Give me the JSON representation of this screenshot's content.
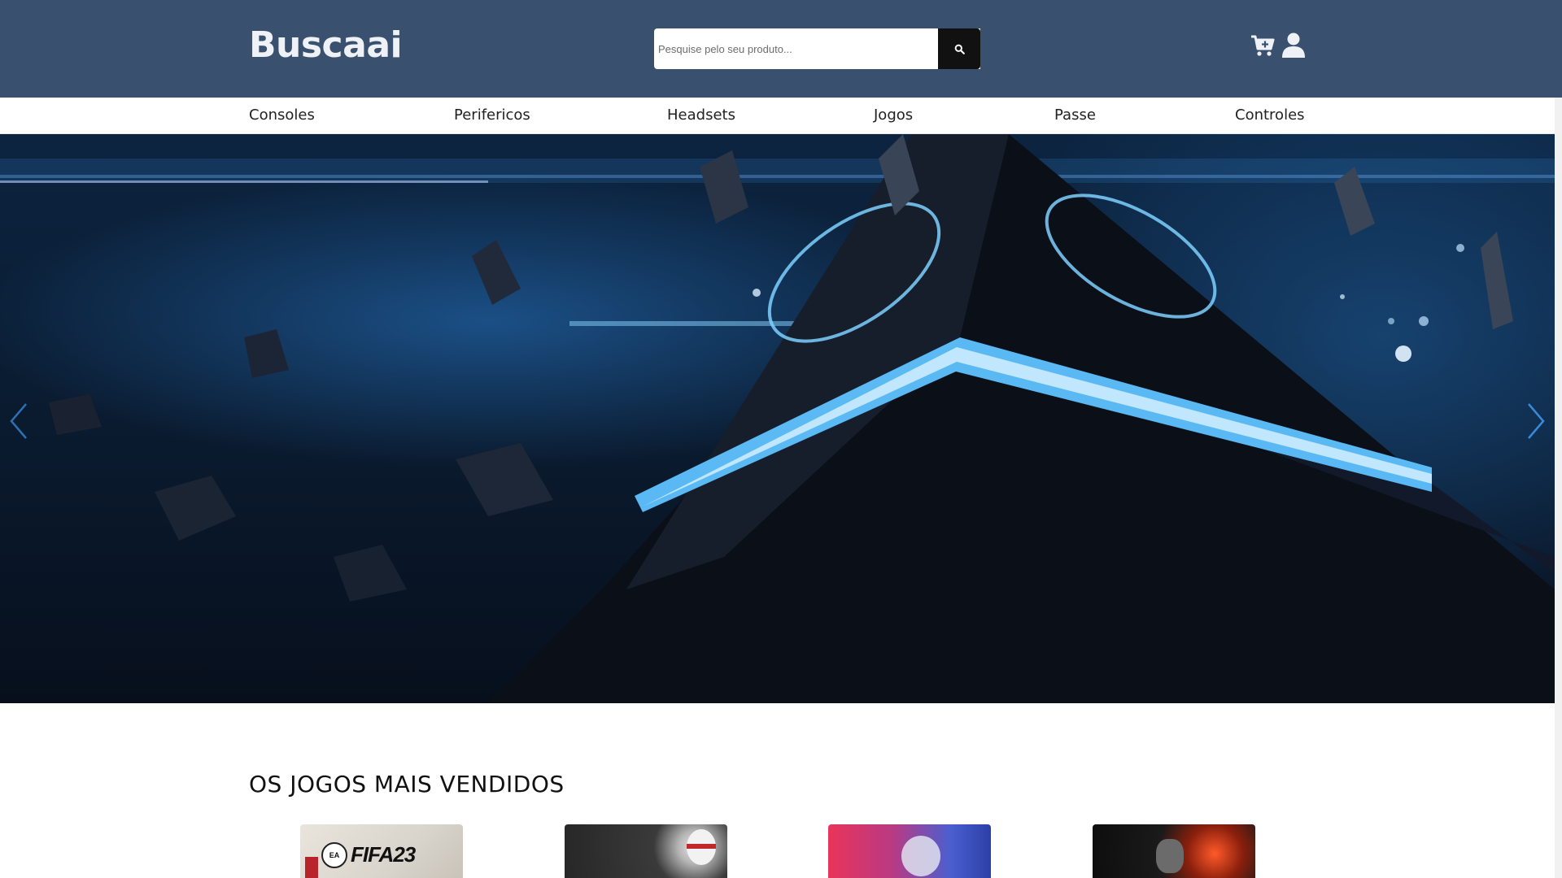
{
  "header": {
    "logo": "Buscaai",
    "search_placeholder": "Pesquise pelo seu produto...",
    "search_icon": "search-icon",
    "cart_icon": "cart-plus-icon",
    "user_icon": "user-icon"
  },
  "nav": {
    "items": [
      {
        "label": "Consoles"
      },
      {
        "label": "Perifericos"
      },
      {
        "label": "Headsets"
      },
      {
        "label": "Jogos"
      },
      {
        "label": "Passe"
      },
      {
        "label": "Controles"
      }
    ]
  },
  "hero": {
    "prev_icon": "chevron-left-icon",
    "next_icon": "chevron-right-icon"
  },
  "best_sellers": {
    "title": "OS JOGOS MAIS VENDIDOS",
    "products": [
      {
        "label": "FIFA23",
        "badge": "EA"
      },
      {
        "label": ""
      },
      {
        "label": ""
      },
      {
        "label": ""
      }
    ]
  },
  "colors": {
    "header_bg": "#3a506f",
    "logo": "#eef1f5",
    "search_button": "#111111",
    "accent_glow": "#5abfff"
  }
}
